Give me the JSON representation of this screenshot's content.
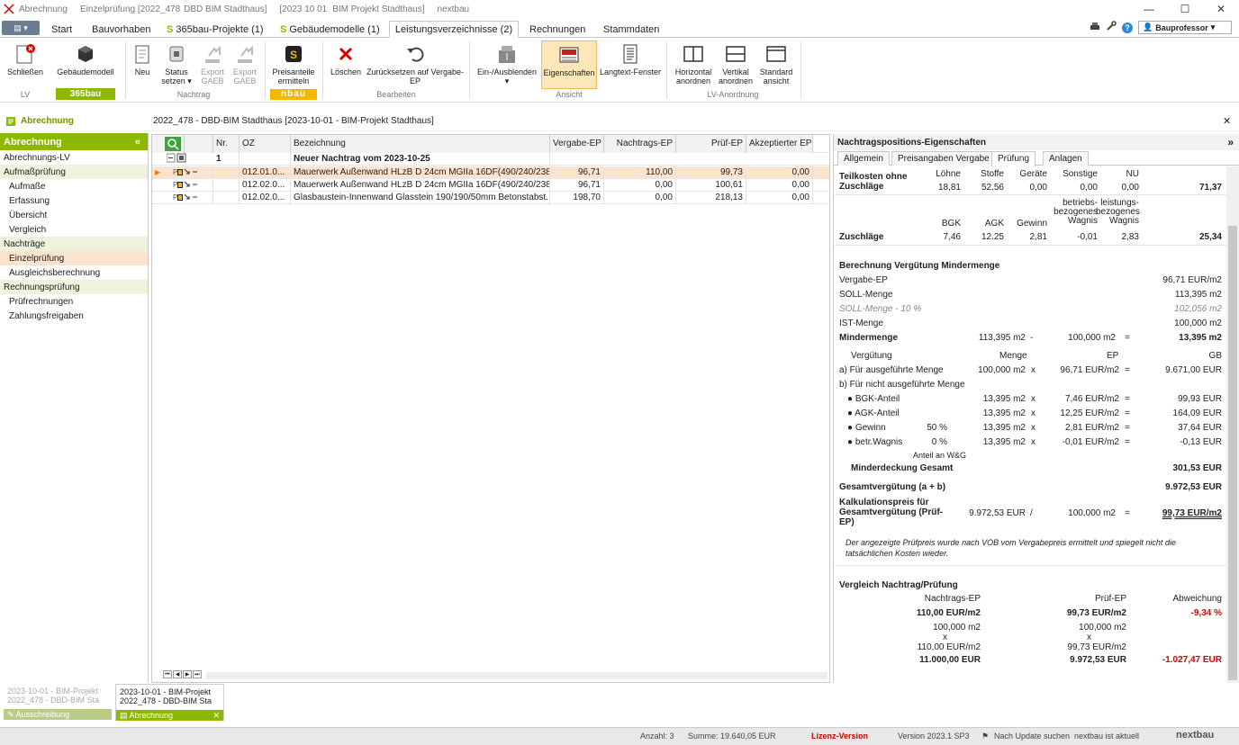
{
  "window": {
    "title_parts": [
      "Abrechnung",
      "Einzelprüfung [2022_478",
      "DBD BIM Stadthaus]",
      "[2023 10 01",
      "BIM Projekt Stadthaus]",
      "nextbau"
    ],
    "min": "—",
    "max": "☐",
    "close": "✕"
  },
  "menu": {
    "file": "▤ ▾",
    "tabs": [
      "Start",
      "Bauvorhaben",
      "365bau-Projekte (1)",
      "Gebäudemodelle (1)",
      "Leistungsverzeichnisse (2)",
      "Rechnungen",
      "Stammdaten"
    ],
    "s_mark": "S",
    "user": "Bauprofessor",
    "help": "?"
  },
  "ribbon": {
    "close": "Schließen",
    "building_model": "Gebäudemodell",
    "new": "Neu",
    "status_set": "Status setzen ▾",
    "export_gaeb": "Export GAEB",
    "export_gaeb2": "Export GAEB",
    "price_shares": "Preisanteile ermitteln",
    "delete": "Löschen",
    "reset": "Zurücksetzen auf Vergabe-EP",
    "show_hide": "Ein-/Ausblenden ▾",
    "properties": "Eigenschaften",
    "longtext": "Langtext-Fenster",
    "horizontal": "Horizontal anordnen",
    "vertical": "Vertikal anordnen",
    "standard": "Standard ansicht",
    "groups": {
      "lv": "LV",
      "nachtrag": "Nachtrag",
      "bearbeiten": "Bearbeiten",
      "ansicht": "Ansicht",
      "lv_anordnung": "LV-Anordnung"
    },
    "badge365": "365bau",
    "badgenb": "nbau"
  },
  "path": {
    "section": "Abrechnung",
    "text": "2022_478 - DBD-BIM Stadthaus [2023-10-01 - BIM-Projekt Stadthaus]",
    "close": "✕"
  },
  "sidebar": {
    "title": "Abrechnung",
    "collapse": "«",
    "items": [
      {
        "label": "Abrechnungs-LV",
        "type": "top"
      },
      {
        "label": "Aufmaßprüfung",
        "type": "sec"
      },
      {
        "label": "Aufmaße",
        "type": "sub"
      },
      {
        "label": "Erfassung",
        "type": "sub"
      },
      {
        "label": "Übersicht",
        "type": "sub"
      },
      {
        "label": "Vergleich",
        "type": "sub"
      },
      {
        "label": "Nachträge",
        "type": "sec"
      },
      {
        "label": "Einzelprüfung",
        "type": "sel"
      },
      {
        "label": "Ausgleichsberechnung",
        "type": "sub"
      },
      {
        "label": "Rechnungsprüfung",
        "type": "sec"
      },
      {
        "label": "Prüfrechnungen",
        "type": "sub"
      },
      {
        "label": "Zahlungsfreigaben",
        "type": "sub"
      }
    ]
  },
  "grid": {
    "headers": [
      "Nr.",
      "OZ",
      "Bezeichnung",
      "Vergabe-EP",
      "Nachtrags-EP",
      "Prüf-EP",
      "Akzeptierter EP"
    ],
    "group": {
      "nr": "1",
      "label": "Neuer Nachtrag vom 2023-10-25"
    },
    "rows": [
      {
        "oz": "012.01.0...",
        "text": "Mauerwerk Außenwand HLzB D 24cm MGIIa 16DF(490/240/238)",
        "vergabe": "96,71",
        "nachtrag": "110,00",
        "pruef": "99,73",
        "akz": "0,00"
      },
      {
        "oz": "012.02.0...",
        "text": "Mauerwerk Außenwand HLzB D 24cm MGIIa 16DF(490/240/238)",
        "vergabe": "96,71",
        "nachtrag": "0,00",
        "pruef": "100,61",
        "akz": "0,00"
      },
      {
        "oz": "012.02.0...",
        "text": "Glasbaustein-Innenwand Glasstein 190/190/50mm Betonstabst...",
        "vergabe": "198,70",
        "nachtrag": "0,00",
        "pruef": "218,13",
        "akz": "0,00"
      }
    ],
    "nav": "⏮ ◀ ▶ ⏭"
  },
  "panel": {
    "title": "Nachtragspositions-Eigenschaften",
    "expand": "»",
    "tabs": [
      "Allgemein",
      "Preisangaben Vergabe",
      "Prüfung",
      "Anlagen"
    ],
    "tk": {
      "label": "Teilkosten ohne Zuschläge",
      "h": [
        "Löhne",
        "Stoffe",
        "Geräte",
        "Sonstige",
        "NU"
      ],
      "v": [
        "18,81",
        "52.56",
        "0,00",
        "0,00",
        "0,00"
      ],
      "sum": "71,37"
    },
    "zu": {
      "label": "Zuschläge",
      "h": [
        "BGK",
        "AGK",
        "Gewinn",
        "betriebs-bezogenes Wagnis",
        "leistungs-bezogenes Wagnis"
      ],
      "v": [
        "7,46",
        "12.25",
        "2,81",
        "-0,01",
        "2,83"
      ],
      "sum": "25,34"
    },
    "mm": {
      "title": "Berechnung Vergütung Mindermenge",
      "rows": [
        [
          "Vergabe-EP",
          "96,71 EUR/m2"
        ],
        [
          "SOLL-Menge",
          "113,395 m2"
        ],
        [
          "SOLL-Menge - 10 %",
          "102,056 m2"
        ],
        [
          "IST-Menge",
          "100,000 m2"
        ]
      ],
      "minder": {
        "label": "Mindermenge",
        "a": "113,395 m2",
        "op1": "-",
        "b": "100,000 m2",
        "eq": "=",
        "r": "13,395 m2"
      },
      "hdr": {
        "verg": "Vergütung",
        "menge": "Menge",
        "ep": "EP",
        "gb": "GB"
      },
      "a": {
        "label": "a) Für ausgeführte Menge",
        "m": "100,000 m2",
        "x": "x",
        "ep": "96,71 EUR/m2",
        "eq": "=",
        "gb": "9.671,00 EUR"
      },
      "b": "b) Für nicht ausgeführte Menge",
      "parts": [
        {
          "label": "● BGK-Anteil",
          "pct": "",
          "m": "13,395 m2",
          "ep": "7,46 EUR/m2",
          "gb": "99,93 EUR"
        },
        {
          "label": "● AGK-Anteil",
          "pct": "",
          "m": "13,395 m2",
          "ep": "12,25 EUR/m2",
          "gb": "164,09 EUR"
        },
        {
          "label": "● Gewinn",
          "pct": "50 %",
          "m": "13,395 m2",
          "ep": "2,81 EUR/m2",
          "gb": "37,64 EUR"
        },
        {
          "label": "● betr.Wagnis",
          "pct": "0 %",
          "m": "13,395 m2",
          "ep": "-0,01 EUR/m2",
          "gb": "-0,13 EUR"
        }
      ],
      "anteil": "Anteil an W&G",
      "minderdeckung": {
        "label": "Minderdeckung Gesamt",
        "v": "301,53 EUR"
      },
      "gesamt": {
        "label": "Gesamtvergütung (a + b)",
        "v": "9.972,53 EUR"
      },
      "kalk": {
        "label": "Kalkulationspreis für Gesamtvergütung (Prüf-EP)",
        "a": "9.972,53 EUR",
        "op": "/",
        "b": "100,000 m2",
        "eq": "=",
        "r": "99,73 EUR/m2"
      },
      "note": "Der angezeigte Prüfpreis wurde nach VOB vom Vergabepreis ermittelt und spiegelt nicht die tatsächlichen Kosten wieder."
    },
    "cmp": {
      "title": "Vergleich Nachtrag/Prüfung",
      "h": [
        "Nachtrags-EP",
        "Prüf-EP",
        "Abweichung"
      ],
      "r1": [
        "110,00 EUR/m2",
        "99,73 EUR/m2",
        "-9,34 %"
      ],
      "r2a": [
        "100,000 m2",
        "100,000 m2"
      ],
      "x": "x",
      "r2b": [
        "110,00 EUR/m2",
        "99,73 EUR/m2"
      ],
      "r3": [
        "11.000,00 EUR",
        "9.972,53 EUR",
        "-1.027,47 EUR"
      ]
    }
  },
  "bottom": {
    "tab1": [
      "2023-10-01 - BIM-Projekt",
      "2022_478 - DBD-BIM Sta"
    ],
    "tab1name": "Ausschreibung",
    "tab2": [
      "2023-10-01 - BIM-Projekt",
      "2022_478 - DBD-BIM Sta"
    ],
    "tab2name": "Abrechnung",
    "x": "✕"
  },
  "status": {
    "count": "Anzahl: 3",
    "sum": "Summe: 19.640,05 EUR",
    "license": "Lizenz-Version",
    "version": "Version 2023.1 SP3",
    "update": "Nach Update suchen",
    "uptodate": "nextbau ist aktuell",
    "logo": "nextbau"
  },
  "colors": {
    "accent": "#8cb800",
    "selected": "#fbe3cd",
    "red": "#d00000"
  }
}
